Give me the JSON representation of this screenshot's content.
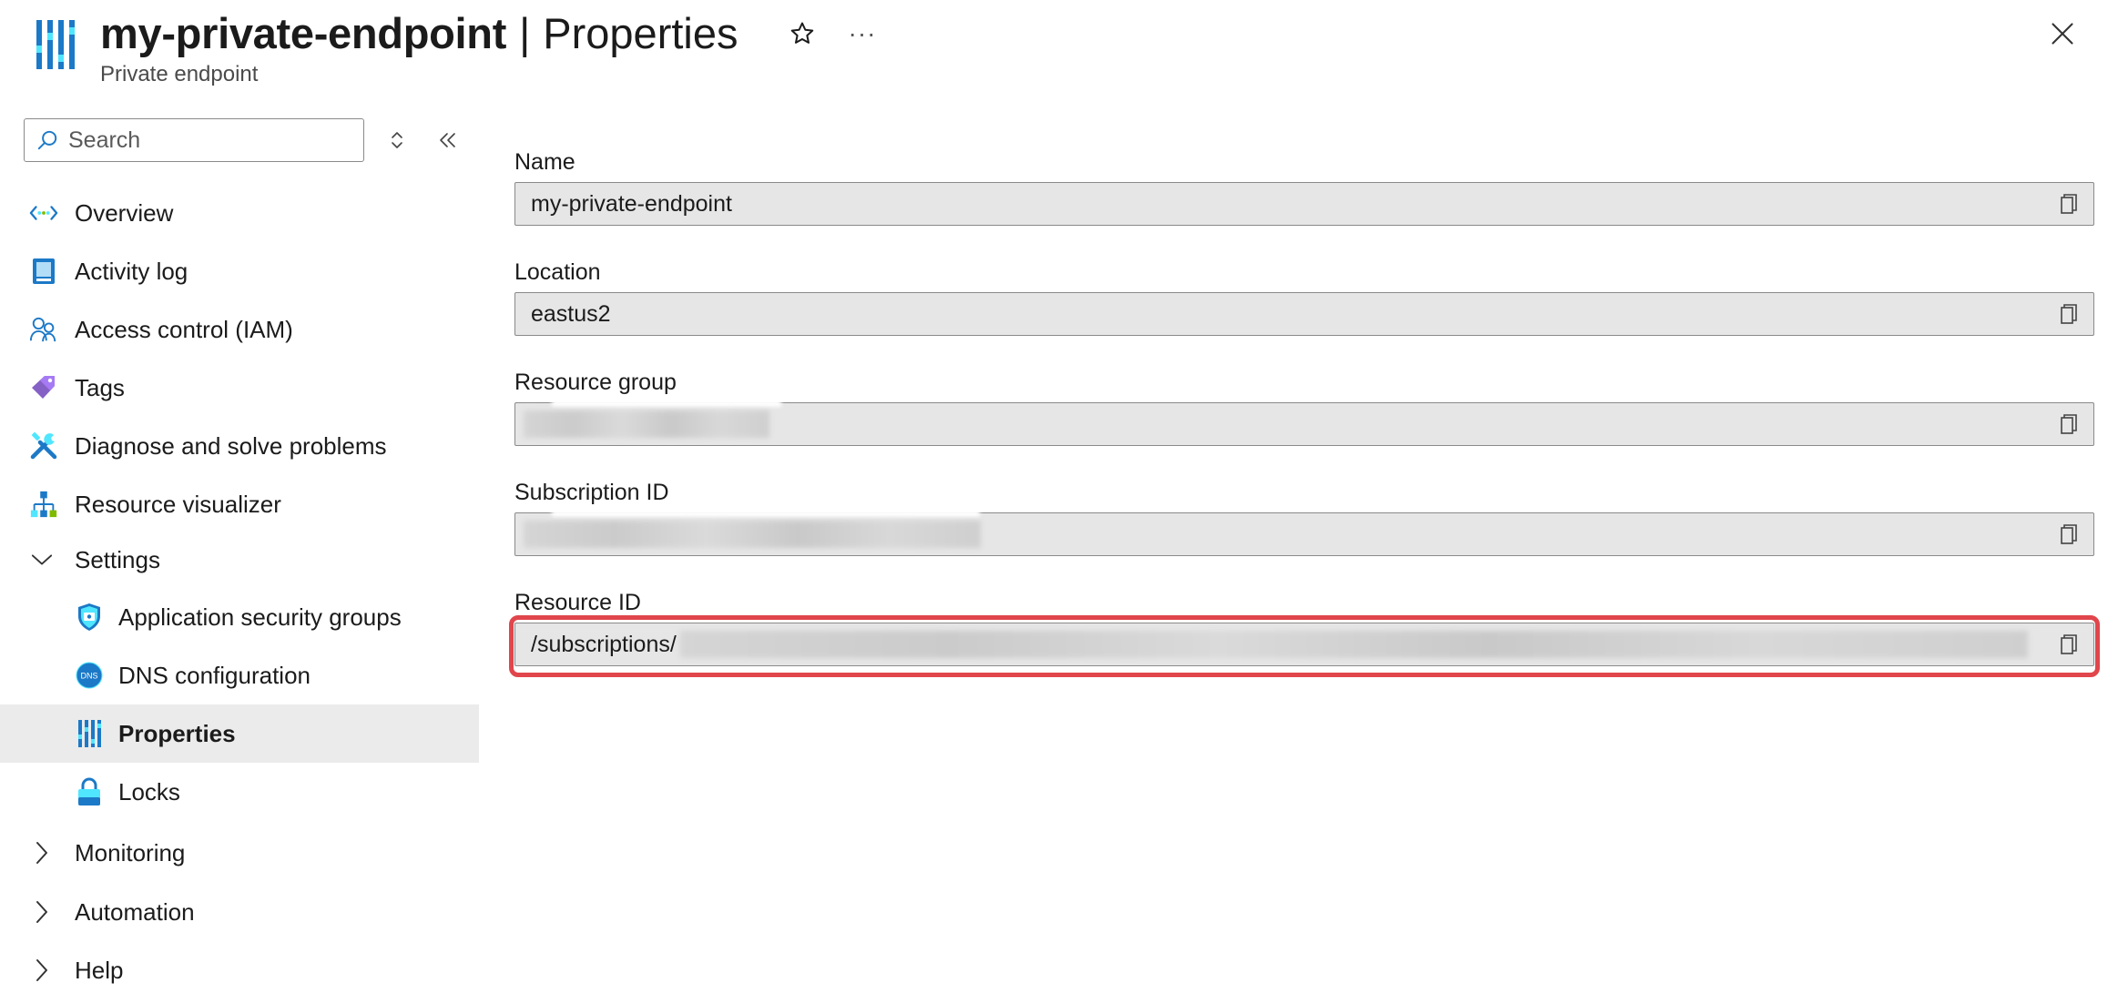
{
  "header": {
    "resource_name": "my-private-endpoint",
    "separator": "|",
    "section": "Properties",
    "subtitle": "Private endpoint",
    "favorite_icon": "star-icon",
    "more_icon": "more-icon",
    "more_glyph": "···",
    "close_icon": "close-icon"
  },
  "sidebar": {
    "search_placeholder": "Search",
    "items": [
      {
        "label": "Overview",
        "icon": "overview-icon"
      },
      {
        "label": "Activity log",
        "icon": "activity-log-icon"
      },
      {
        "label": "Access control (IAM)",
        "icon": "iam-icon"
      },
      {
        "label": "Tags",
        "icon": "tag-icon"
      },
      {
        "label": "Diagnose and solve problems",
        "icon": "wrench-icon"
      },
      {
        "label": "Resource visualizer",
        "icon": "visualizer-icon"
      }
    ],
    "settings_group": {
      "label": "Settings",
      "expanded": true,
      "children": [
        {
          "label": "Application security groups",
          "icon": "shield-icon"
        },
        {
          "label": "DNS configuration",
          "icon": "dns-icon",
          "icon_text": "DNS"
        },
        {
          "label": "Properties",
          "icon": "properties-icon",
          "selected": true
        },
        {
          "label": "Locks",
          "icon": "lock-icon"
        }
      ]
    },
    "collapsed_groups": [
      {
        "label": "Monitoring"
      },
      {
        "label": "Automation"
      },
      {
        "label": "Help"
      }
    ]
  },
  "main": {
    "fields": [
      {
        "label": "Name",
        "value": "my-private-endpoint",
        "redacted": false
      },
      {
        "label": "Location",
        "value": "eastus2",
        "redacted": false
      },
      {
        "label": "Resource group",
        "value": "",
        "redacted": true
      },
      {
        "label": "Subscription ID",
        "value": "",
        "redacted": true
      },
      {
        "label": "Resource ID",
        "value": "/subscriptions/",
        "redacted": true,
        "highlighted": true
      }
    ]
  },
  "colors": {
    "accent_blue": "#0078d4",
    "highlight_red": "#e0464b",
    "field_bg": "#e6e6e6",
    "selected_bg": "#ebebeb"
  }
}
